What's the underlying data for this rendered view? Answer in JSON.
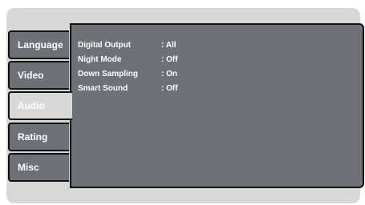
{
  "tabs": [
    {
      "label": "Language",
      "active": false
    },
    {
      "label": "Video",
      "active": false
    },
    {
      "label": "Audio",
      "active": true
    },
    {
      "label": "Rating",
      "active": false
    },
    {
      "label": "Misc",
      "active": false
    }
  ],
  "settings": [
    {
      "label": "Digital Output",
      "value": ": All"
    },
    {
      "label": "Night Mode",
      "value": ": Off"
    },
    {
      "label": "Down Sampling",
      "value": ": On"
    },
    {
      "label": "Smart Sound",
      "value": ": Off"
    }
  ],
  "colors": {
    "tab_bg": "#6c7277",
    "active_tab_bg": "#d8d8d8",
    "panel_bg": "#6c7277",
    "outline": "#111111",
    "text": "#ffffff"
  }
}
